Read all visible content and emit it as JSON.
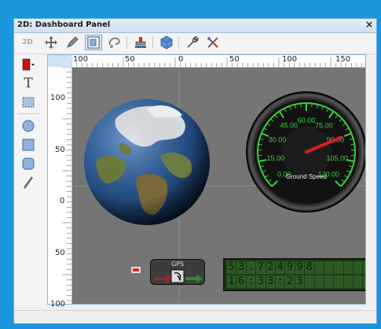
{
  "panel": {
    "title": "2D: Dashboard Panel",
    "close": "×"
  },
  "toolbar": {
    "mode_label": "2D",
    "items": [
      {
        "icon": "move-icon"
      },
      {
        "icon": "pencil-icon"
      },
      {
        "icon": "select-icon",
        "active": true
      },
      {
        "icon": "lasso-icon"
      },
      {
        "icon": "stamp-icon"
      },
      {
        "icon": "shape-icon"
      },
      {
        "icon": "wrench-icon"
      },
      {
        "icon": "tools-icon"
      }
    ]
  },
  "left_tools": {
    "color": "#cc1111",
    "text_tool": "T",
    "items": [
      "color-picker-icon",
      "text-icon",
      "marquee-icon",
      "circle-icon",
      "rectangle-icon",
      "rounded-rect-icon",
      "line-icon"
    ]
  },
  "rulers": {
    "horizontal": [
      "100",
      "50",
      "0",
      "50",
      "100",
      "150"
    ],
    "vertical": [
      "100",
      "50",
      "0",
      "50",
      "100"
    ]
  },
  "gauge": {
    "labels": [
      "0.00",
      "15.00",
      "30.00",
      "45.00",
      "60.00",
      "75.00",
      "90.00",
      "105.00",
      "120.00"
    ],
    "title": "Ground Speed",
    "value": 90
  },
  "gps": {
    "label": "GPS"
  },
  "lcd": {
    "row1": [
      "5",
      "3",
      ".",
      "7",
      "2",
      "4",
      "9",
      "9",
      "8",
      "",
      "",
      "",
      "",
      "",
      "",
      ""
    ],
    "row2": [
      "1",
      "6",
      ":",
      "3",
      "3",
      ":",
      "2",
      "3",
      "",
      "",
      "",
      "",
      "",
      "",
      "",
      ""
    ]
  },
  "colors": {
    "frame": "#1b95db",
    "view_bg": "#757575",
    "gauge_green": "#3bd13b",
    "needle": "#d62020"
  }
}
